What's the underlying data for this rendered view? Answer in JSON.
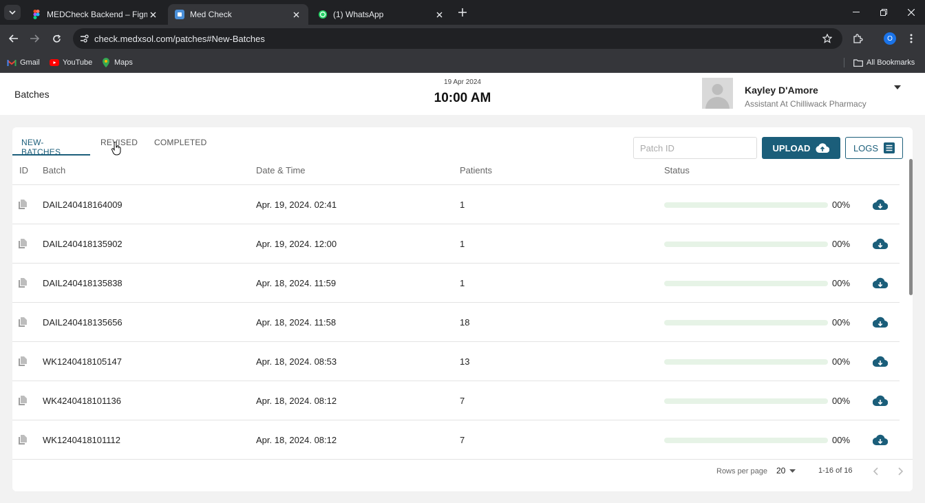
{
  "browser": {
    "tabs": [
      {
        "title": "MEDCheck Backend – Figma",
        "icon": "figma-icon",
        "active": false
      },
      {
        "title": "Med Check",
        "icon": "medcheck-icon",
        "active": true
      },
      {
        "title": "(1) WhatsApp",
        "icon": "whatsapp-icon",
        "active": false
      }
    ],
    "url": "check.medxsol.com/patches#New-Batches",
    "profile_initial": "O",
    "bookmarks": [
      {
        "label": "Gmail",
        "icon": "gmail-icon"
      },
      {
        "label": "YouTube",
        "icon": "youtube-icon"
      },
      {
        "label": "Maps",
        "icon": "maps-icon"
      }
    ],
    "all_bookmarks": "All Bookmarks"
  },
  "header": {
    "page_title": "Batches",
    "date": "19 Apr 2024",
    "time": "10:00 AM",
    "user": {
      "name": "Kayley D'Amore",
      "role": "Assistant At Chilliwack Pharmacy"
    }
  },
  "tabs": [
    {
      "label": "NEW-BATCHES",
      "active": true
    },
    {
      "label": "REVISED",
      "active": false
    },
    {
      "label": "COMPLETED",
      "active": false
    }
  ],
  "toolbar": {
    "search_placeholder": "Patch ID",
    "upload_label": "UPLOAD",
    "logs_label": "LOGS"
  },
  "table": {
    "columns": [
      "ID",
      "Batch",
      "Date & Time",
      "Patients",
      "Status"
    ],
    "rows": [
      {
        "batch": "DAIL240418164009",
        "datetime": "Apr. 19, 2024. 02:41",
        "patients": "1",
        "status": "00%",
        "progress": 0
      },
      {
        "batch": "DAIL240418135902",
        "datetime": "Apr. 19, 2024. 12:00",
        "patients": "1",
        "status": "00%",
        "progress": 0
      },
      {
        "batch": "DAIL240418135838",
        "datetime": "Apr. 18, 2024. 11:59",
        "patients": "1",
        "status": "00%",
        "progress": 0
      },
      {
        "batch": "DAIL240418135656",
        "datetime": "Apr. 18, 2024. 11:58",
        "patients": "18",
        "status": "00%",
        "progress": 0
      },
      {
        "batch": "WK1240418105147",
        "datetime": "Apr. 18, 2024. 08:53",
        "patients": "13",
        "status": "00%",
        "progress": 0
      },
      {
        "batch": "WK4240418101136",
        "datetime": "Apr. 18, 2024. 08:12",
        "patients": "7",
        "status": "00%",
        "progress": 0
      },
      {
        "batch": "WK1240418101112",
        "datetime": "Apr. 18, 2024. 08:12",
        "patients": "7",
        "status": "00%",
        "progress": 0
      }
    ]
  },
  "pagination": {
    "rows_per_page_label": "Rows per page",
    "rows_per_page": "20",
    "range": "1-16 of 16"
  },
  "colors": {
    "primary": "#1b5e7a",
    "progress_track": "#e6f3e6"
  }
}
